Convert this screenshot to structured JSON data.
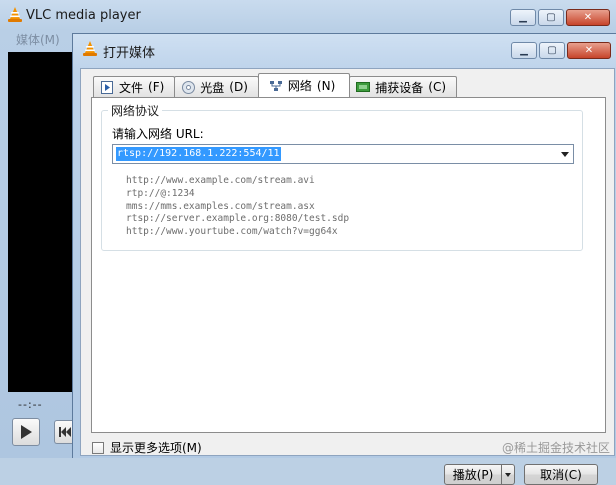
{
  "main_window": {
    "title": "VLC media player",
    "menu_label": "媒体(M)",
    "time_label": "--:--"
  },
  "dialog": {
    "title": "打开媒体",
    "tabs": [
      {
        "label": "文件",
        "accel": "(F)",
        "icon": "file-icon"
      },
      {
        "label": "光盘",
        "accel": "(D)",
        "icon": "disc-icon"
      },
      {
        "label": "网络",
        "accel": "(N)",
        "icon": "network-icon",
        "active": true
      },
      {
        "label": "捕获设备",
        "accel": "(C)",
        "icon": "capture-device-icon"
      }
    ],
    "network": {
      "group_title": "网络协议",
      "url_label": "请输入网络 URL:",
      "url_value": "rtsp://192.168.1.222:554/11",
      "examples": [
        "http://www.example.com/stream.avi",
        "rtp://@:1234",
        "mms://mms.examples.com/stream.asx",
        "rtsp://server.example.org:8080/test.sdp",
        "http://www.yourtube.com/watch?v=gg64x"
      ]
    },
    "show_more_label": "显示更多选项(M)",
    "play_label": "播放(P)",
    "cancel_label": "取消(C)"
  },
  "watermark": "@稀土掘金技术社区",
  "colors": {
    "selection": "#3399ff",
    "vlc_orange": "#f39200",
    "title_bar": "#bcd2ea"
  }
}
